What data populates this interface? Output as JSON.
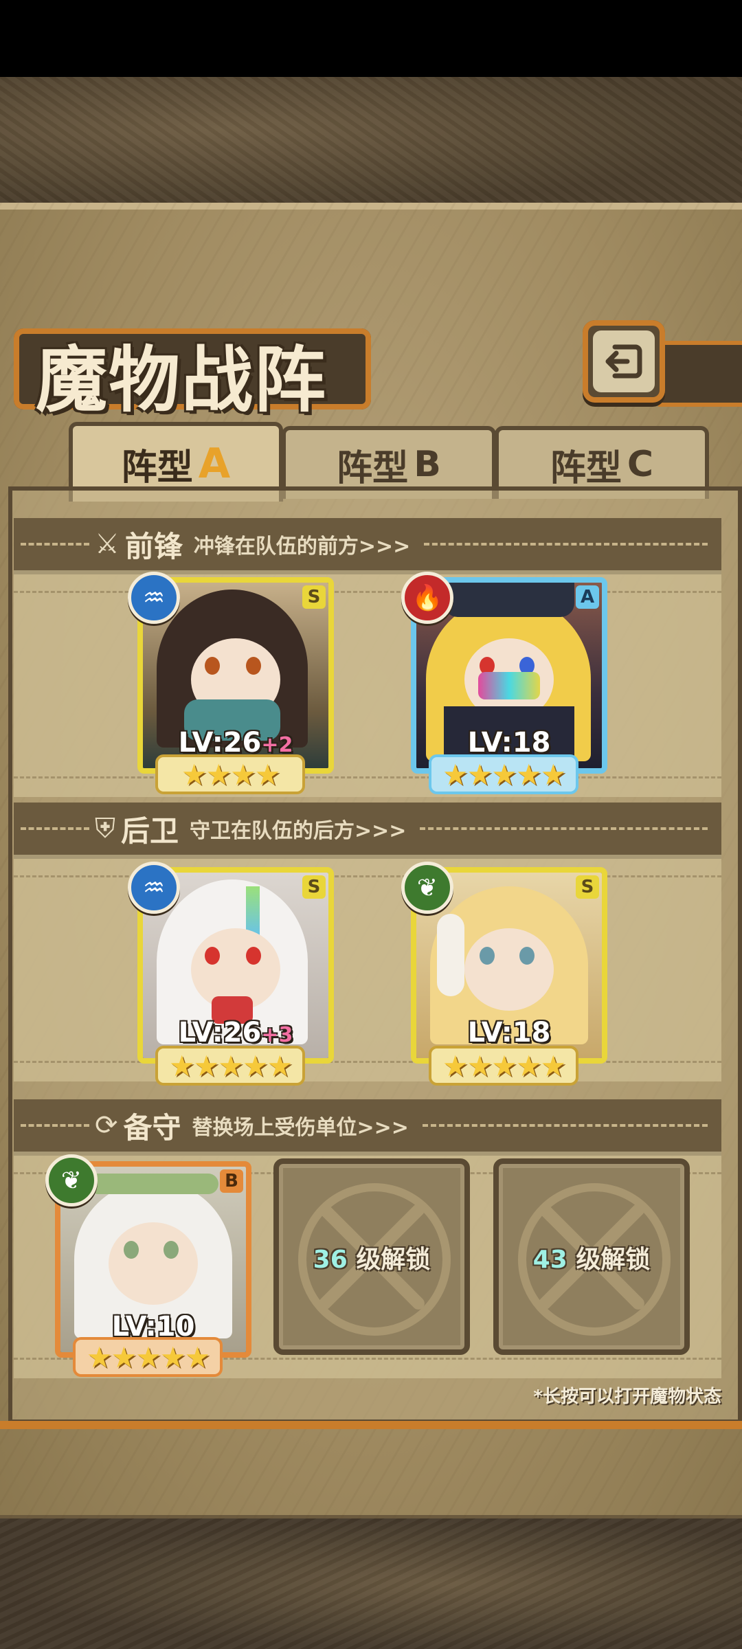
{
  "title": "魔物战阵",
  "tabs": [
    {
      "label": "阵型",
      "letter": "A",
      "active": true
    },
    {
      "label": "阵型",
      "letter": "B",
      "active": false
    },
    {
      "label": "阵型",
      "letter": "C",
      "active": false
    }
  ],
  "sections": {
    "front": {
      "name": "前锋",
      "desc": "冲锋在队伍的前方>>>",
      "icon": "sword-icon"
    },
    "back": {
      "name": "后卫",
      "desc": "守卫在队伍的后方>>>",
      "icon": "shield-icon"
    },
    "reserve": {
      "name": "备守",
      "desc": "替换场上受伤单位>>>",
      "icon": "swap-icon"
    }
  },
  "units": {
    "front1": {
      "rank": "S",
      "element": "water",
      "level": "LV:26",
      "bonus": "+2",
      "stars": "★★★★",
      "star_count": 4
    },
    "front2": {
      "rank": "A",
      "element": "fire",
      "level": "LV:18",
      "bonus": "",
      "stars": "★★★★★",
      "star_count": 5
    },
    "back1": {
      "rank": "S",
      "element": "water",
      "level": "LV:26",
      "bonus": "+3",
      "stars": "★★★★★",
      "star_count": 5
    },
    "back2": {
      "rank": "S",
      "element": "grass",
      "level": "LV:18",
      "bonus": "",
      "stars": "★★★★★",
      "star_count": 5
    },
    "reserve1": {
      "rank": "B",
      "element": "grass",
      "level": "LV:10",
      "bonus": "",
      "stars": "★★★★★",
      "star_count": 5
    }
  },
  "locked_slots": [
    {
      "level": "36",
      "suffix": "级解锁"
    },
    {
      "level": "43",
      "suffix": "级解锁"
    }
  ],
  "hint": "*长按可以打开魔物状态",
  "colors": {
    "rank_s": "#e9d63a",
    "rank_a": "#6cc7ec",
    "rank_b": "#e48a3a",
    "accent": "#c97d2b"
  }
}
